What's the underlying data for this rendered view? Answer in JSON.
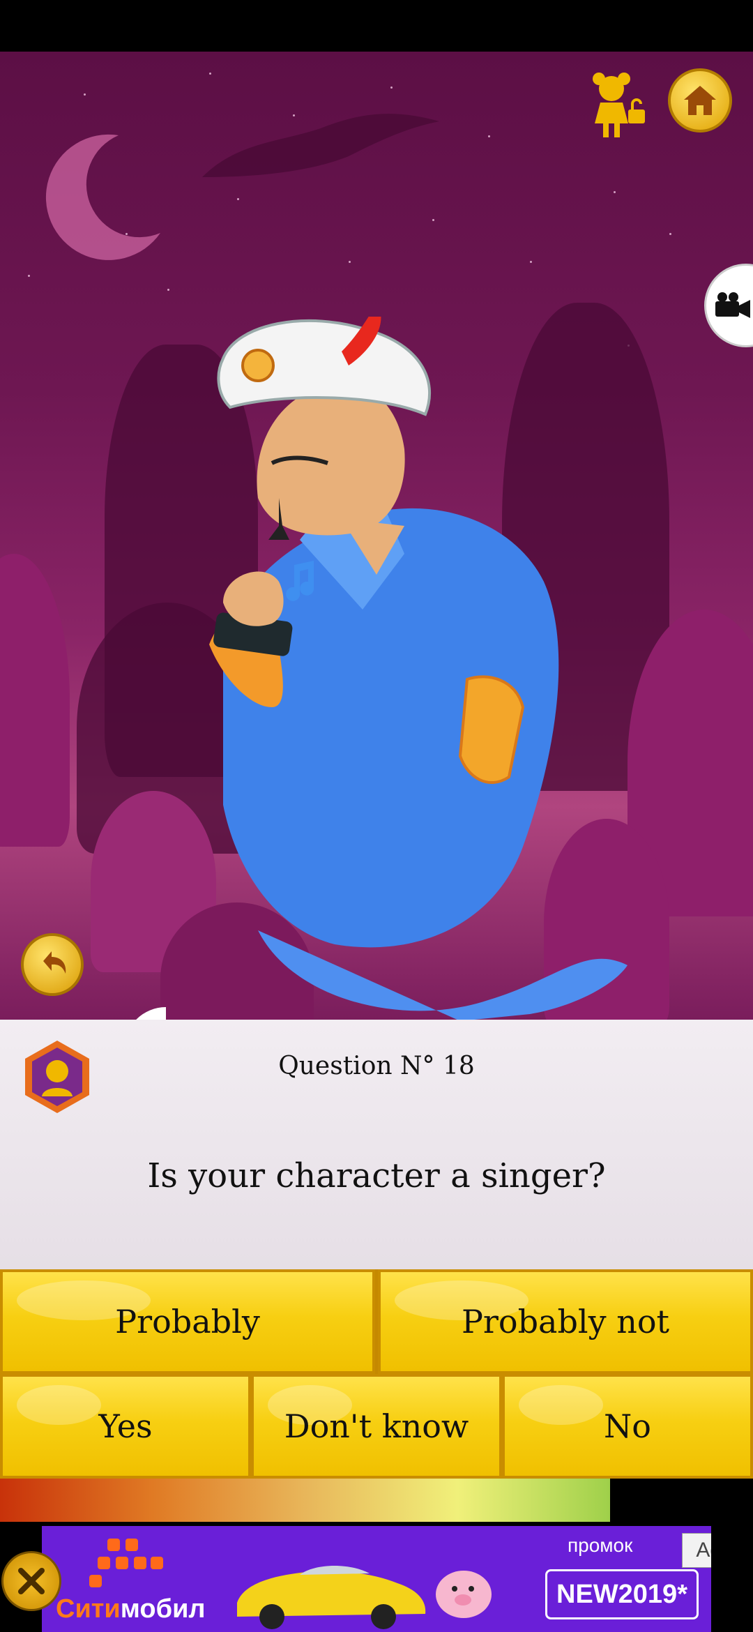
{
  "top_icons": {
    "kid_mode": "child-lock-icon",
    "home": "home-icon",
    "video": "video-camera-icon",
    "undo": "undo-icon"
  },
  "question": {
    "badge_icon": "profile-badge-icon",
    "number_label": "Question N° 18",
    "text": "Is your character a singer?"
  },
  "answers": {
    "probably": "Probably",
    "probably_not": "Probably not",
    "yes": "Yes",
    "dont_know": "Don't know",
    "no": "No"
  },
  "progress": {
    "fraction": 0.81
  },
  "ad": {
    "brand_part1": "Сити",
    "brand_part2": "мобил",
    "promo_label": "промок",
    "promo_code": "NEW2019*",
    "choice_label": "Ad",
    "close_icon": "close-icon"
  },
  "colors": {
    "button_yellow": "#f7cf12",
    "scene_purple": "#6e1752",
    "ad_background": "#6a1fd8"
  }
}
